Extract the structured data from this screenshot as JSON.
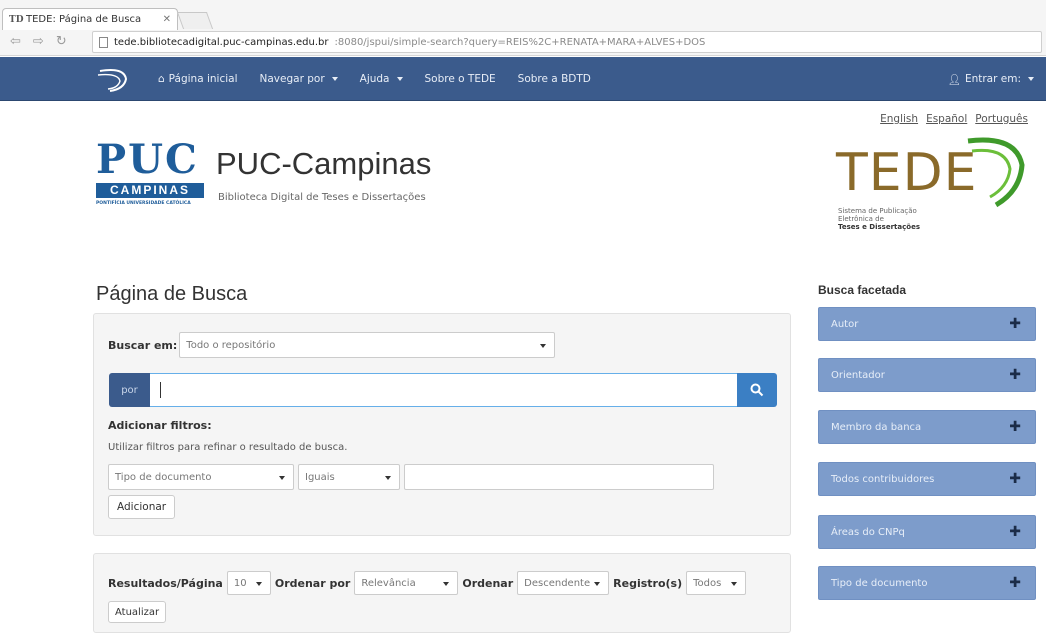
{
  "browser": {
    "tab_title": "TEDE: Página de Busca",
    "tab_favicon": "TD",
    "tab_close": "✕",
    "url_host": "tede.bibliotecadigital.puc-campinas.edu.br",
    "url_rest": ":8080/jspui/simple-search?query=REIS%2C+RENATA+MARA+ALVES+DOS"
  },
  "navbar": {
    "items": [
      {
        "label": "Página inicial",
        "icon": "home-icon"
      },
      {
        "label": "Navegar por",
        "dropdown": true
      },
      {
        "label": "Ajuda",
        "dropdown": true
      },
      {
        "label": "Sobre o TEDE"
      },
      {
        "label": "Sobre a BDTD"
      }
    ],
    "login_label": "Entrar em:"
  },
  "languages": [
    "English",
    "Español",
    "Português"
  ],
  "header": {
    "puc_letters": "PUC",
    "puc_bar": "CAMPINAS",
    "puc_small": "PONTIFÍCIA UNIVERSIDADE CATÓLICA",
    "site_title": "PUC-Campinas",
    "site_subtitle": "Biblioteca Digital de Teses e Dissertações",
    "tede_word": "TEDE",
    "tede_sub1": "Sistema de Publicação",
    "tede_sub2": "Eletrônica de",
    "tede_sub3": "Teses e Dissertações"
  },
  "page_heading": "Página de Busca",
  "search": {
    "scope_label": "Buscar em:",
    "scope_value": "Todo o repositório",
    "query_prefix": "por",
    "query_value": "",
    "filters_title": "Adicionar filtros:",
    "filters_desc": "Utilizar filtros para refinar o resultado de busca.",
    "filter_field": "Tipo de documento",
    "filter_op": "Iguais",
    "filter_value": "",
    "add_button": "Adicionar"
  },
  "results": {
    "per_page_label": "Resultados/Página",
    "per_page_value": "10",
    "sort_by_label": "Ordenar por",
    "sort_by_value": "Relevância",
    "order_label": "Ordenar",
    "order_value": "Descendente",
    "records_label": "Registro(s)",
    "records_value": "Todos",
    "refresh_button": "Atualizar"
  },
  "facets": {
    "title": "Busca facetada",
    "items": [
      "Autor",
      "Orientador",
      "Membro da banca",
      "Todos contribuidores",
      "Áreas do CNPq",
      "Tipo de documento"
    ]
  },
  "colors": {
    "navbar": "#3b5b8c",
    "facet": "#7d9ccb",
    "search_button": "#3b7fc4",
    "puc_blue": "#1f5d9a",
    "tede_brown": "#8a6a2a",
    "tede_green": "#3f9a2b"
  }
}
